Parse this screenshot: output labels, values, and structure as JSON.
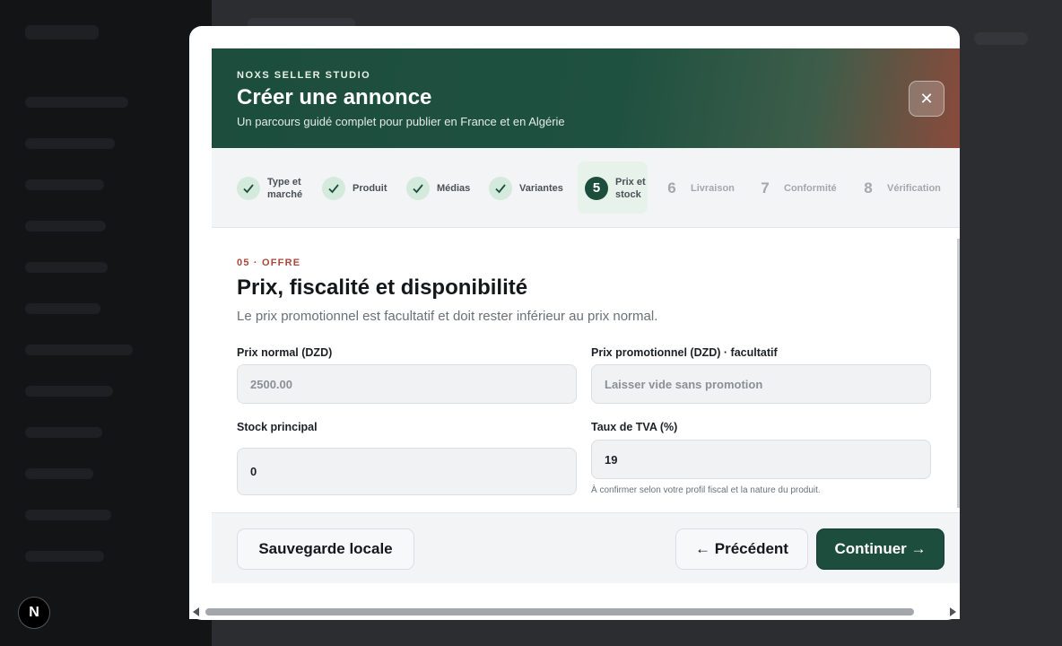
{
  "background": {
    "badge_letter": "N"
  },
  "modal": {
    "brand": "NOXS SELLER STUDIO",
    "title": "Créer une annonce",
    "subtitle": "Un parcours guidé complet pour publier en France et en Algérie",
    "close_symbol": "✕",
    "close_icon": "close-icon"
  },
  "steps": [
    {
      "number": "1",
      "label": "Type et marché",
      "status": "done"
    },
    {
      "number": "2",
      "label": "Produit",
      "status": "done"
    },
    {
      "number": "3",
      "label": "Médias",
      "status": "done"
    },
    {
      "number": "4",
      "label": "Variantes",
      "status": "done"
    },
    {
      "number": "5",
      "label": "Prix et stock",
      "status": "active"
    },
    {
      "number": "6",
      "label": "Livraison",
      "status": "pending"
    },
    {
      "number": "7",
      "label": "Conformité",
      "status": "pending"
    },
    {
      "number": "8",
      "label": "Vérification",
      "status": "pending"
    }
  ],
  "section": {
    "tag": "05 · OFFRE",
    "title": "Prix, fiscalité et disponibilité",
    "description": "Le prix promotionnel est facultatif et doit rester inférieur au prix normal."
  },
  "fields": {
    "price": {
      "label": "Prix normal (DZD)",
      "value": "2500.00"
    },
    "promo": {
      "label": "Prix promotionnel (DZD) · facultatif",
      "placeholder": "Laisser vide sans promotion"
    },
    "stock": {
      "label": "Stock principal",
      "value": "0"
    },
    "vat": {
      "label": "Taux de TVA (%)",
      "value": "19",
      "hint": "À confirmer selon votre profil fiscal et la nature du produit."
    }
  },
  "footer": {
    "save_label": "Sauvegarde locale",
    "prev_label": "← Précédent",
    "next_label": "Continuer →"
  },
  "colors": {
    "brand_green": "#1c4d3d",
    "accent_red": "#a8483c",
    "done_bg": "#d3eadc"
  }
}
